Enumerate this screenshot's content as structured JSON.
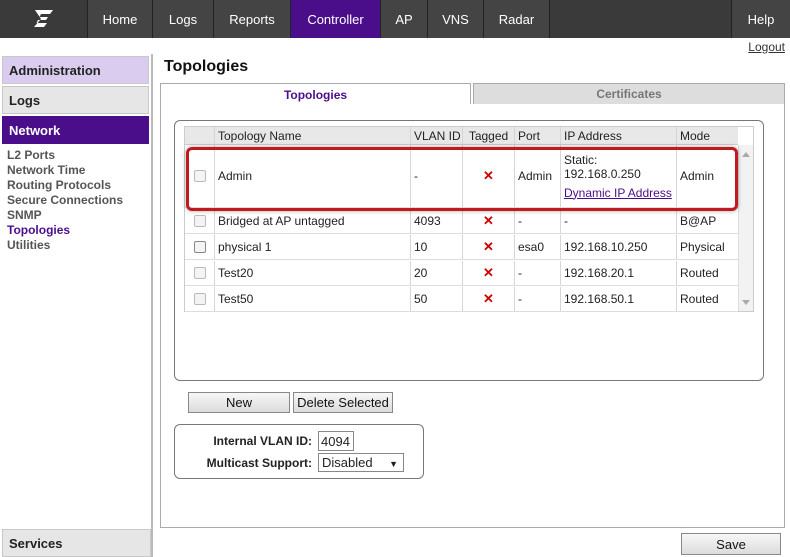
{
  "nav": {
    "items": [
      "Home",
      "Logs",
      "Reports",
      "Controller",
      "AP",
      "VNS",
      "Radar"
    ],
    "active": "Controller",
    "help": "Help",
    "logout": "Logout"
  },
  "sidebar": {
    "administration": "Administration",
    "logs": "Logs",
    "network": "Network",
    "links": [
      "L2 Ports",
      "Network Time",
      "Routing Protocols",
      "Secure Connections",
      "SNMP",
      "Topologies",
      "Utilities"
    ],
    "active_link": "Topologies",
    "services": "Services"
  },
  "page": {
    "title": "Topologies",
    "tabs": [
      "Topologies",
      "Certificates"
    ]
  },
  "table": {
    "headers": [
      "Topology Name",
      "VLAN ID",
      "Tagged",
      "Port",
      "IP Address",
      "Mode"
    ],
    "rows": [
      {
        "name": "Admin",
        "vlan": "-",
        "tagged": "✕",
        "port": "Admin",
        "ip_line1": "Static:",
        "ip_line2": "192.168.0.250",
        "ip_link": "Dynamic IP Address",
        "mode": "Admin"
      },
      {
        "name": "Bridged at AP untagged",
        "vlan": "4093",
        "tagged": "✕",
        "port": "-",
        "ip": "-",
        "mode": "B@AP"
      },
      {
        "name": "physical 1",
        "vlan": "10",
        "tagged": "✕",
        "port": "esa0",
        "ip": "192.168.10.250",
        "mode": "Physical"
      },
      {
        "name": "Test20",
        "vlan": "20",
        "tagged": "✕",
        "port": "-",
        "ip": "192.168.20.1",
        "mode": "Routed"
      },
      {
        "name": "Test50",
        "vlan": "50",
        "tagged": "✕",
        "port": "-",
        "ip": "192.168.50.1",
        "mode": "Routed"
      }
    ]
  },
  "buttons": {
    "new": "New",
    "delete": "Delete Selected",
    "save": "Save"
  },
  "settings": {
    "internal_vlan_label": "Internal VLAN ID:",
    "internal_vlan_value": "4094",
    "multicast_label": "Multicast Support:",
    "multicast_value": "Disabled"
  },
  "colors": {
    "accent": "#4b0e8a",
    "highlight": "#c0191f",
    "x_mark": "#d10000"
  }
}
